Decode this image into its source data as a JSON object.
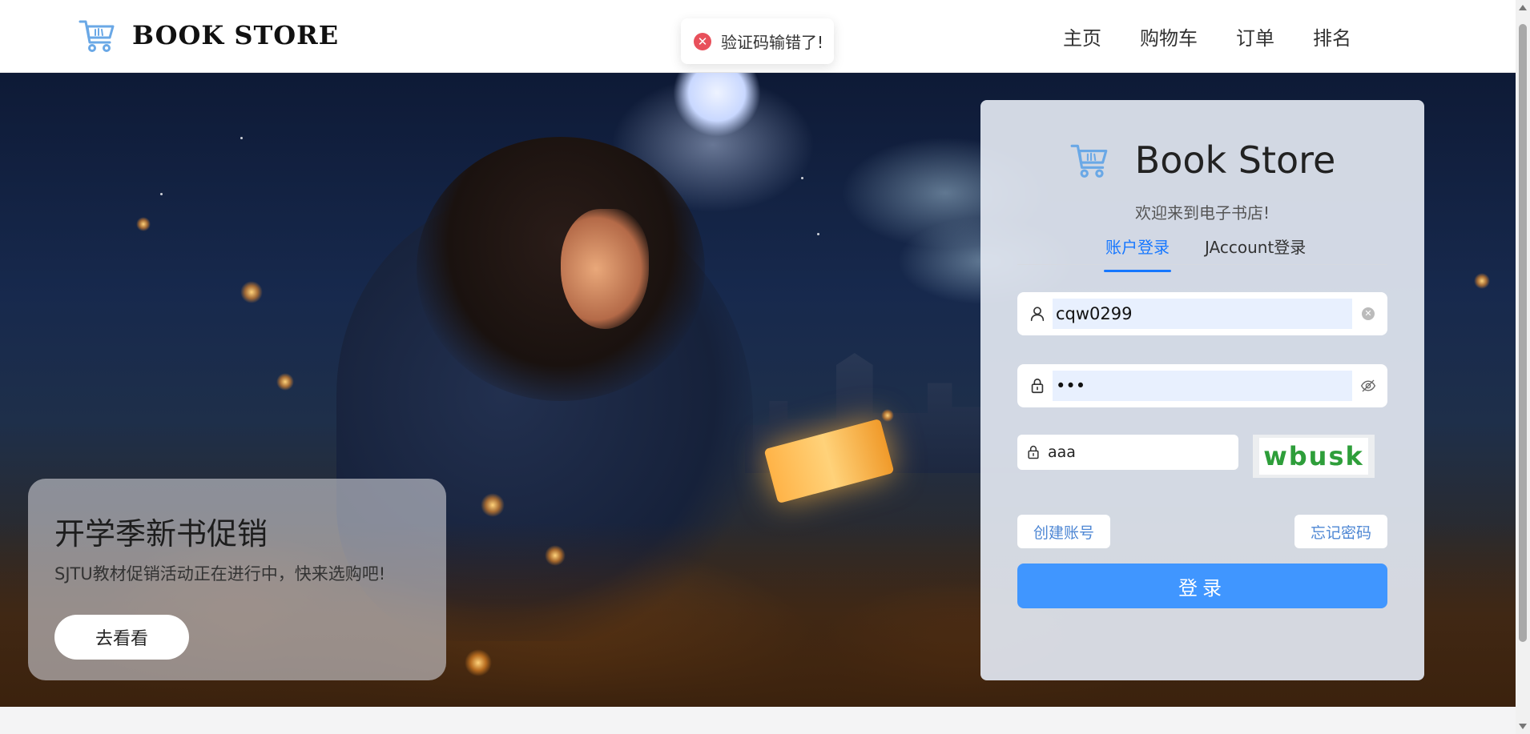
{
  "header": {
    "logo_text": "BOOK STORE",
    "nav": [
      "主页",
      "购物车",
      "订单",
      "排名"
    ]
  },
  "toast": {
    "type": "error",
    "message": "验证码输错了!"
  },
  "promo": {
    "title": "开学季新书促销",
    "subtitle": "SJTU教材促销活动正在进行中，快来选购吧!",
    "button_label": "去看看"
  },
  "login": {
    "title": "Book Store",
    "welcome": "欢迎来到电子书店!",
    "tabs": [
      "账户登录",
      "JAccount登录"
    ],
    "active_tab": "账户登录",
    "username": "cqw0299",
    "password": "•••",
    "captcha_input": "aaa",
    "captcha_code": "wbusk",
    "create_label": "创建账号",
    "forgot_label": "忘记密码",
    "submit_label": "登录"
  },
  "colors": {
    "accent": "#1677ff",
    "submit": "#4096ff",
    "error": "#e8505b",
    "captcha_text": "#2e9e3a"
  }
}
